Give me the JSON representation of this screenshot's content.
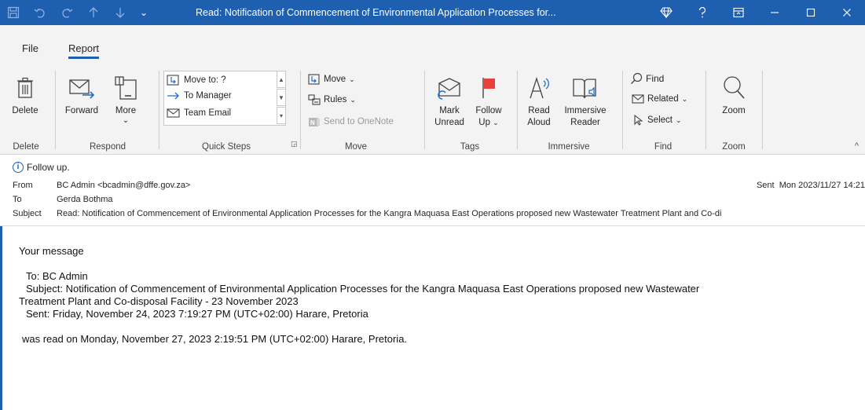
{
  "titlebar": {
    "title": "Read: Notification of Commencement of Environmental Application Processes for...",
    "quick_access_dropdown": "⌄"
  },
  "tabs": [
    "File",
    "Report"
  ],
  "ribbon": {
    "delete_group": {
      "delete_label": "Delete",
      "group_label": "Delete"
    },
    "respond_group": {
      "forward_label": "Forward",
      "more_label": "More",
      "group_label": "Respond"
    },
    "quick_steps": {
      "items": [
        "Move to: ?",
        "To Manager",
        "Team Email"
      ],
      "group_label": "Quick Steps"
    },
    "move_group": {
      "move_label": "Move",
      "rules_label": "Rules",
      "onenote_label": "Send to OneNote",
      "group_label": "Move"
    },
    "tags_group": {
      "mark_unread_line1": "Mark",
      "mark_unread_line2": "Unread",
      "follow_up_line1": "Follow",
      "follow_up_line2": "Up",
      "group_label": "Tags"
    },
    "immersive_group": {
      "read_aloud_line1": "Read",
      "read_aloud_line2": "Aloud",
      "immersive_line1": "Immersive",
      "immersive_line2": "Reader",
      "group_label": "Immersive"
    },
    "find_group": {
      "find_label": "Find",
      "related_label": "Related",
      "select_label": "Select",
      "group_label": "Find"
    },
    "zoom_group": {
      "zoom_label": "Zoom",
      "group_label": "Zoom"
    }
  },
  "header": {
    "follow_up": "Follow up.",
    "from_label": "From",
    "from_value": "BC Admin <bcadmin@dffe.gov.za>",
    "to_label": "To",
    "to_value": "Gerda Bothma",
    "subject_label": "Subject",
    "subject_value": "Read: Notification of Commencement of Environmental Application Processes for the Kangra Maquasa East Operations proposed new Wastewater Treatment Plant and Co-di",
    "sent_label": "Sent",
    "sent_value": "Mon 2023/11/27 14:21"
  },
  "body": {
    "line1": "Your message",
    "to_line": "To: BC Admin",
    "subject_line1": "Subject: Notification of Commencement of Environmental Application Processes for the Kangra Maquasa East Operations proposed new Wastewater",
    "subject_line2": "Treatment Plant and Co-disposal Facility - 23 November 2023",
    "sent_line": "Sent: Friday, November 24, 2023 7:19:27 PM (UTC+02:00) Harare, Pretoria",
    "read_line": "was read on Monday, November 27, 2023 2:19:51 PM (UTC+02:00) Harare, Pretoria."
  }
}
